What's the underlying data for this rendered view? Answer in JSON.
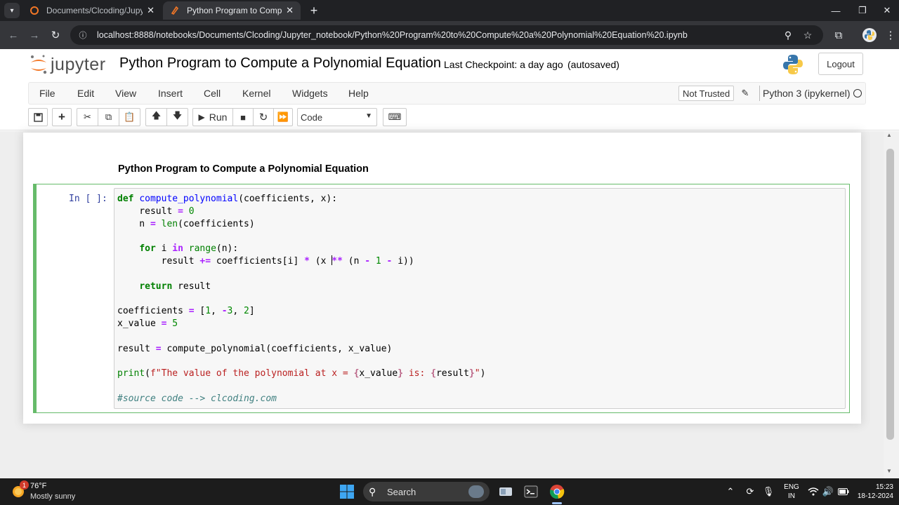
{
  "browser": {
    "tabs": [
      {
        "title": "Documents/Clcoding/Jupyter_n"
      },
      {
        "title": "Python Program to Compute a"
      }
    ],
    "url": "localhost:8888/notebooks/Documents/Clcoding/Jupyter_notebook/Python%20Program%20to%20Compute%20a%20Polynomial%20Equation%20.ipynb",
    "icons": {
      "tab_menu": "chevron-down-icon",
      "new_tab": "plus-icon",
      "back": "arrow-left-icon",
      "forward": "arrow-right-icon",
      "reload": "reload-icon",
      "zoom": "zoom-icon",
      "bookmark": "star-icon",
      "extensions": "puzzle-icon"
    }
  },
  "jupyter": {
    "logo_text": "jupyter",
    "notebook_title": "Python Program to Compute a Polynomial Equation",
    "checkpoint": "Last Checkpoint: a day ago",
    "autosave": "(autosaved)",
    "logout_label": "Logout",
    "menu": [
      "File",
      "Edit",
      "View",
      "Insert",
      "Cell",
      "Kernel",
      "Widgets",
      "Help"
    ],
    "trust_label": "Not Trusted",
    "kernel_name": "Python 3 (ipykernel)",
    "toolbar": {
      "run_label": "Run",
      "cell_type": "Code"
    }
  },
  "notebook": {
    "markdown_heading": "Python Program to Compute a Polynomial Equation",
    "cell_prompt": "In [ ]:",
    "code_lines": [
      "def compute_polynomial(coefficients, x):",
      "    result = 0",
      "    n = len(coefficients)",
      "",
      "    for i in range(n):",
      "        result += coefficients[i] * (x ** (n - 1 - i))",
      "",
      "    return result",
      "",
      "coefficients = [1, -3, 2]",
      "x_value = 5",
      "",
      "result = compute_polynomial(coefficients, x_value)",
      "",
      "print(f\"The value of the polynomial at x = {x_value} is: {result}\")",
      "",
      "#source code --> clcoding.com"
    ]
  },
  "taskbar": {
    "weather_temp": "76°F",
    "weather_desc": "Mostly sunny",
    "weather_badge": "1",
    "search_label": "Search",
    "lang_line1": "ENG",
    "lang_line2": "IN",
    "time": "15:23",
    "date": "18-12-2024"
  },
  "colors": {
    "chrome_dark": "#202124",
    "chrome_mid": "#35363a",
    "cell_selected_border": "#66bb6a",
    "prompt_color": "#303f9f",
    "keyword": "#008000",
    "function": "#0000ff",
    "string": "#ba2121",
    "comment": "#408080"
  }
}
